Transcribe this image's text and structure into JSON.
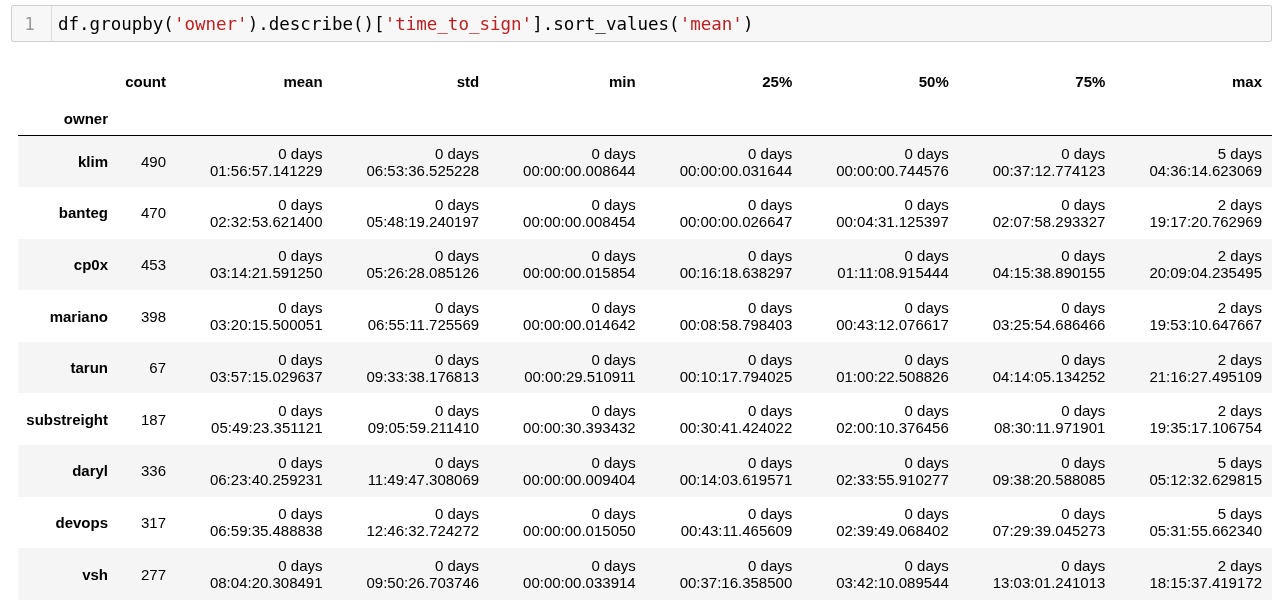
{
  "code_cell": {
    "line_number": "1",
    "tokens": [
      {
        "text": "df.groupby(",
        "kind": "plain"
      },
      {
        "text": "'owner'",
        "kind": "string"
      },
      {
        "text": ").describe()[",
        "kind": "plain"
      },
      {
        "text": "'time_to_sign'",
        "kind": "string"
      },
      {
        "text": "].sort_values(",
        "kind": "plain"
      },
      {
        "text": "'mean'",
        "kind": "string"
      },
      {
        "text": ")",
        "kind": "plain"
      }
    ]
  },
  "table": {
    "columns": [
      "count",
      "mean",
      "std",
      "min",
      "25%",
      "50%",
      "75%",
      "max"
    ],
    "index_name": "owner",
    "rows": [
      {
        "index": "klim",
        "cells": [
          [
            "490"
          ],
          [
            "0 days",
            "01:56:57.141229"
          ],
          [
            "0 days",
            "06:53:36.525228"
          ],
          [
            "0 days",
            "00:00:00.008644"
          ],
          [
            "0 days",
            "00:00:00.031644"
          ],
          [
            "0 days",
            "00:00:00.744576"
          ],
          [
            "0 days",
            "00:37:12.774123"
          ],
          [
            "5 days",
            "04:36:14.623069"
          ]
        ]
      },
      {
        "index": "banteg",
        "cells": [
          [
            "470"
          ],
          [
            "0 days",
            "02:32:53.621400"
          ],
          [
            "0 days",
            "05:48:19.240197"
          ],
          [
            "0 days",
            "00:00:00.008454"
          ],
          [
            "0 days",
            "00:00:00.026647"
          ],
          [
            "0 days",
            "00:04:31.125397"
          ],
          [
            "0 days",
            "02:07:58.293327"
          ],
          [
            "2 days",
            "19:17:20.762969"
          ]
        ]
      },
      {
        "index": "cp0x",
        "cells": [
          [
            "453"
          ],
          [
            "0 days",
            "03:14:21.591250"
          ],
          [
            "0 days",
            "05:26:28.085126"
          ],
          [
            "0 days",
            "00:00:00.015854"
          ],
          [
            "0 days",
            "00:16:18.638297"
          ],
          [
            "0 days",
            "01:11:08.915444"
          ],
          [
            "0 days",
            "04:15:38.890155"
          ],
          [
            "2 days",
            "20:09:04.235495"
          ]
        ]
      },
      {
        "index": "mariano",
        "cells": [
          [
            "398"
          ],
          [
            "0 days",
            "03:20:15.500051"
          ],
          [
            "0 days",
            "06:55:11.725569"
          ],
          [
            "0 days",
            "00:00:00.014642"
          ],
          [
            "0 days",
            "00:08:58.798403"
          ],
          [
            "0 days",
            "00:43:12.076617"
          ],
          [
            "0 days",
            "03:25:54.686466"
          ],
          [
            "2 days",
            "19:53:10.647667"
          ]
        ]
      },
      {
        "index": "tarun",
        "cells": [
          [
            "67"
          ],
          [
            "0 days",
            "03:57:15.029637"
          ],
          [
            "0 days",
            "09:33:38.176813"
          ],
          [
            "0 days",
            "00:00:29.510911"
          ],
          [
            "0 days",
            "00:10:17.794025"
          ],
          [
            "0 days",
            "01:00:22.508826"
          ],
          [
            "0 days",
            "04:14:05.134252"
          ],
          [
            "2 days",
            "21:16:27.495109"
          ]
        ]
      },
      {
        "index": "substreight",
        "cells": [
          [
            "187"
          ],
          [
            "0 days",
            "05:49:23.351121"
          ],
          [
            "0 days",
            "09:05:59.211410"
          ],
          [
            "0 days",
            "00:00:30.393432"
          ],
          [
            "0 days",
            "00:30:41.424022"
          ],
          [
            "0 days",
            "02:00:10.376456"
          ],
          [
            "0 days",
            "08:30:11.971901"
          ],
          [
            "2 days",
            "19:35:17.106754"
          ]
        ]
      },
      {
        "index": "daryl",
        "cells": [
          [
            "336"
          ],
          [
            "0 days",
            "06:23:40.259231"
          ],
          [
            "0 days",
            "11:49:47.308069"
          ],
          [
            "0 days",
            "00:00:00.009404"
          ],
          [
            "0 days",
            "00:14:03.619571"
          ],
          [
            "0 days",
            "02:33:55.910277"
          ],
          [
            "0 days",
            "09:38:20.588085"
          ],
          [
            "5 days",
            "05:12:32.629815"
          ]
        ]
      },
      {
        "index": "devops",
        "cells": [
          [
            "317"
          ],
          [
            "0 days",
            "06:59:35.488838"
          ],
          [
            "0 days",
            "12:46:32.724272"
          ],
          [
            "0 days",
            "00:00:00.015050"
          ],
          [
            "0 days",
            "00:43:11.465609"
          ],
          [
            "0 days",
            "02:39:49.068402"
          ],
          [
            "0 days",
            "07:29:39.045273"
          ],
          [
            "5 days",
            "05:31:55.662340"
          ]
        ]
      },
      {
        "index": "vsh",
        "cells": [
          [
            "277"
          ],
          [
            "0 days",
            "08:04:20.308491"
          ],
          [
            "0 days",
            "09:50:26.703746"
          ],
          [
            "0 days",
            "00:00:00.033914"
          ],
          [
            "0 days",
            "00:37:16.358500"
          ],
          [
            "0 days",
            "03:42:10.089544"
          ],
          [
            "0 days",
            "13:03:01.241013"
          ],
          [
            "2 days",
            "18:15:37.419172"
          ]
        ]
      }
    ]
  }
}
